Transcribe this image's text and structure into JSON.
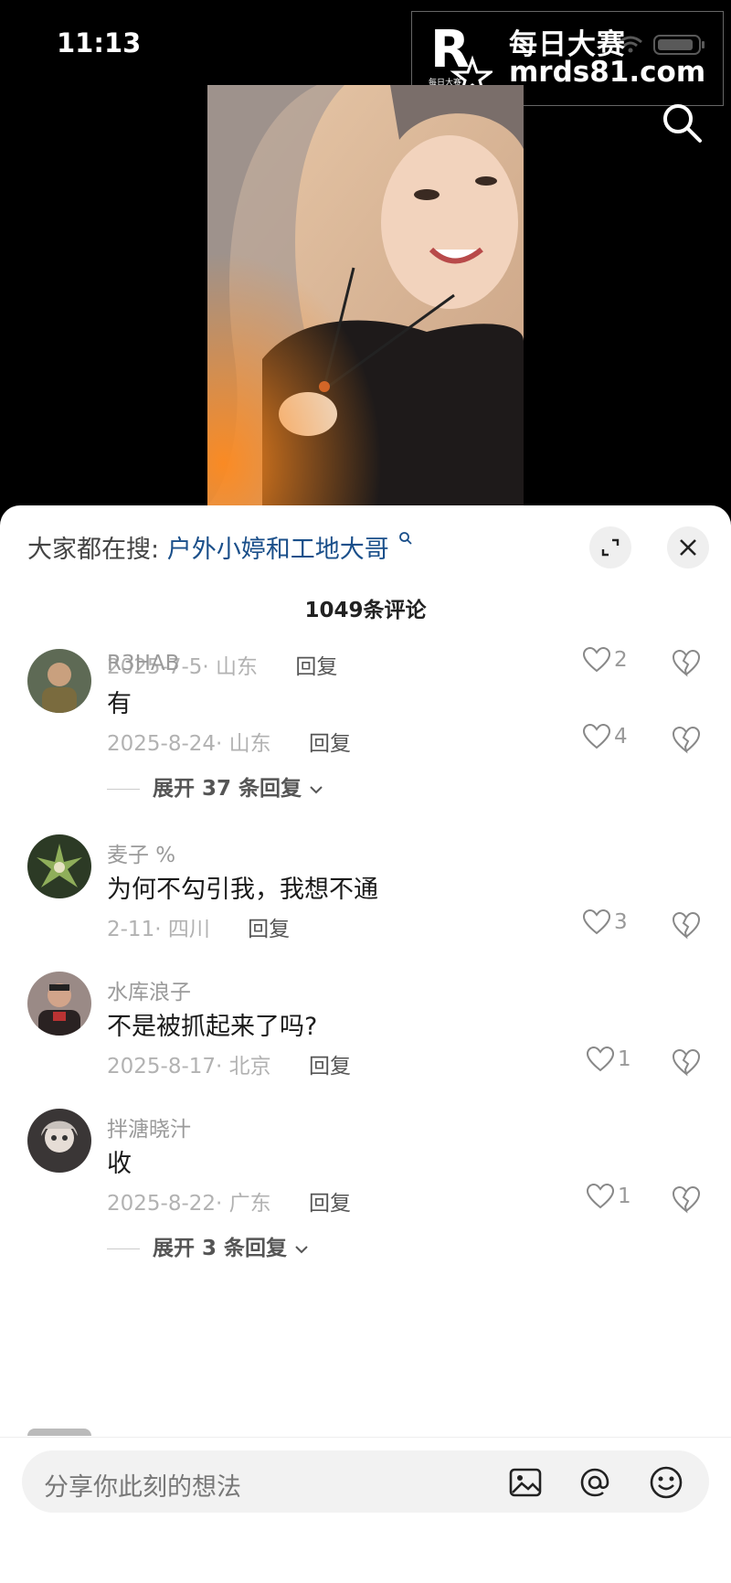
{
  "status_bar": {
    "time": "11:13"
  },
  "watermark": {
    "title": "每日大赛",
    "url": "mrds81.com",
    "logo_letter": "R",
    "logo_sub": "每日大赛"
  },
  "hot_search": {
    "label": "大家都在搜:",
    "term": "户外小婷和工地大哥"
  },
  "comment_count": "1049条评论",
  "reply_label": "回复",
  "comments": [
    {
      "date": "2025-7-5",
      "location": "山东",
      "likes": "2"
    },
    {
      "username": "R3HAB",
      "text": "有",
      "date": "2025-8-24",
      "location": "山东",
      "likes": "4",
      "expand": "展开 37 条回复"
    },
    {
      "username": "麦子 %",
      "text": "为何不勾引我，我想不通",
      "date": "2-11",
      "location": "四川",
      "likes": "3"
    },
    {
      "username": "水库浪子",
      "text": "不是被抓起来了吗?",
      "date": "2025-8-17",
      "location": "北京",
      "likes": "1"
    },
    {
      "username": "拌溏晓汁",
      "text": "收",
      "date": "2025-8-22",
      "location": "广东",
      "likes": "1",
      "expand": "展开 3 条回复"
    }
  ],
  "input": {
    "placeholder": "分享你此刻的想法"
  },
  "colors": {
    "hot_term": "#1a4f8a",
    "sheet_bg": "#ffffff",
    "input_bg": "#f2f2f2"
  }
}
